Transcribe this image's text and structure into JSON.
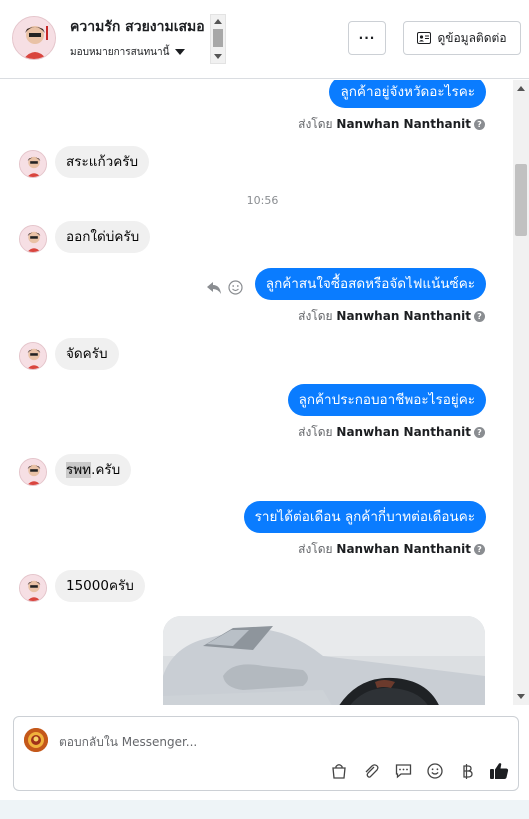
{
  "header": {
    "name": "ความรัก สวยงามเสมอ",
    "subtitle": "มอบหมายการสนทนานี้",
    "more_label": "···",
    "contact_label": "ดูข้อมูลติดต่อ"
  },
  "messages": {
    "m1": "ลูกค้าอยู่จังหวัดอะไรคะ",
    "m2": "สระแก้วครับ",
    "time": "10:56",
    "m3": "ออกใด่บ่ครับ",
    "m4": "ลูกค้าสนใจซื้อสดหรือจัดไฟแน้นซ์คะ",
    "m5": "จัดครับ",
    "m6": "ลูกค้าประกอบอาชีพอะไรอยู่คะ",
    "m7_a": "รพท",
    "m7_b": ".ครับ",
    "m8": "รายได้ต่อเดือน ลูกค้ากี่บาทต่อเดือนคะ",
    "m9": "15000ครับ"
  },
  "sent_by": {
    "prefix": "ส่งโดย",
    "name": "Nanwhan Nanthanit",
    "help": "?"
  },
  "composer": {
    "placeholder": "ตอบกลับใน Messenger..."
  },
  "colors": {
    "outgoing": "#0a7cff",
    "incoming": "#f0f0f0",
    "like": "#1c1e21"
  }
}
